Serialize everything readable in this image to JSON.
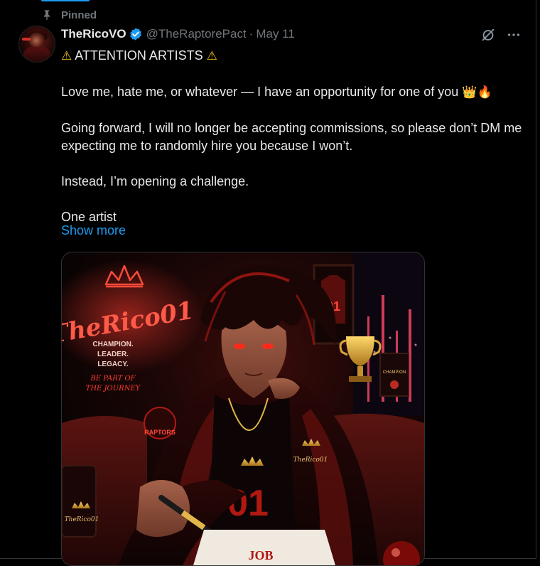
{
  "pinned": {
    "label": "Pinned",
    "icon": "pin-icon"
  },
  "author": {
    "display_name": "TheRicoVO",
    "handle": "@TheRaptorePact",
    "separator": "·",
    "date": "May 11",
    "verified_color": "#1d9bf0"
  },
  "header_icons": [
    "grok-icon",
    "more-icon"
  ],
  "tweet": {
    "line1_text": "ATTENTION ARTISTS",
    "line1_emoji_left": "⚠",
    "line1_emoji_right": "⚠",
    "line2_text": "Love me, hate me, or whatever — I have an opportunity for one of you",
    "line2_emoji_1": "👑",
    "line2_emoji_2": "🔥",
    "line3": "Going forward, I will no longer be accepting commissions, so please don’t DM me expecting me to randomly hire you because I won’t.",
    "line4": "Instead, I’m opening a challenge.",
    "line5": "One artist"
  },
  "show_more": "Show more",
  "media": {
    "neon_title": "TheRico01",
    "tagline_1": "CHAMPION.",
    "tagline_2": "LEADER.",
    "tagline_3": "LEGACY.",
    "script_1": "BE PART OF",
    "script_2": "THE JOURNEY",
    "jersey_number": "01",
    "frame_number": "01",
    "team_badge": "RAPTORS",
    "chest_label": "TheRico01",
    "cup_label": "TheRico01",
    "trophy_plate": "CHAMPION",
    "contract_text": "JOB",
    "accent_color": "#e0281e"
  }
}
